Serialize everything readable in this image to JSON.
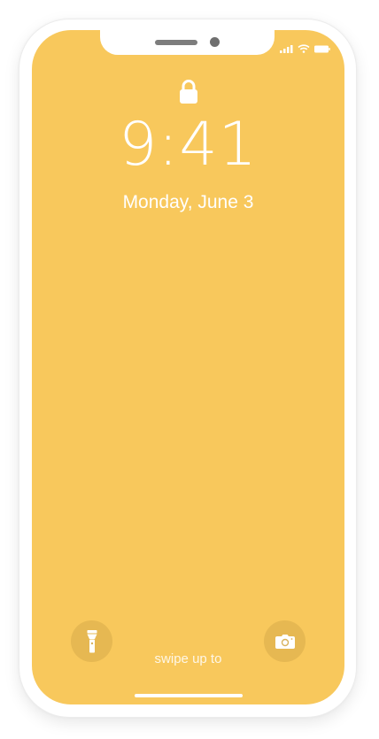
{
  "lock_screen": {
    "time": "9:41",
    "date": "Monday, June 3",
    "swipe_hint": "swipe up to"
  },
  "colors": {
    "wallpaper": "#F8C85C",
    "frame": "#FFFFFF",
    "text": "#FFFFFF"
  },
  "icons": {
    "lock": "lock-icon",
    "signal": "cellular-signal-icon",
    "wifi": "wifi-icon",
    "battery": "battery-icon",
    "flashlight": "flashlight-icon",
    "camera": "camera-icon"
  }
}
